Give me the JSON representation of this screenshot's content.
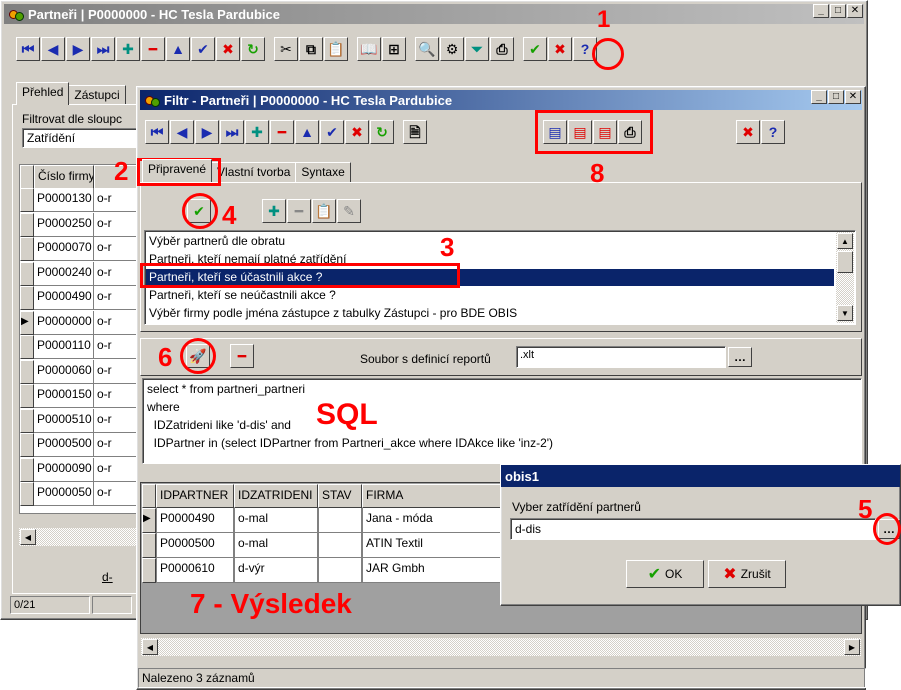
{
  "main_window": {
    "title": "Partneři | P0000000 - HC Tesla Pardubice",
    "tabs": [
      "Přehled",
      "Zástupci"
    ],
    "filter_label": "Filtrovat dle sloupc",
    "sort_value": "Zatřídění",
    "column_header": "Číslo firmy",
    "rows": [
      {
        "id": "P0000130",
        "type": "o-r"
      },
      {
        "id": "P0000250",
        "type": "o-r"
      },
      {
        "id": "P0000070",
        "type": "o-r"
      },
      {
        "id": "P0000240",
        "type": "o-r"
      },
      {
        "id": "P0000490",
        "type": "o-r"
      },
      {
        "id": "P0000000",
        "type": "o-r"
      },
      {
        "id": "P0000110",
        "type": "o-r"
      },
      {
        "id": "P0000060",
        "type": "o-r"
      },
      {
        "id": "P0000150",
        "type": "o-r"
      },
      {
        "id": "P0000510",
        "type": "o-r"
      },
      {
        "id": "P0000500",
        "type": "o-r"
      },
      {
        "id": "P0000090",
        "type": "o-r"
      },
      {
        "id": "P0000050",
        "type": "o-r"
      }
    ],
    "nav_label": "d-",
    "status_count": "0/21"
  },
  "filter_window": {
    "title": "Filtr - Partneři | P0000000 - HC Tesla Pardubice",
    "tabs": [
      "Připravené",
      "Vlastní tvorba",
      "Syntaxe"
    ],
    "filters": [
      "Výběr partnerů dle obratu",
      "Partneři, kteří nemají platné zatřídění",
      "Partneři, kteří se účastnili akce ?",
      "Partneři, kteří se neúčastnili akce ?",
      "Výběr firmy podle jména zástupce z tabulky Zástupci - pro BDE OBIS"
    ],
    "selected_filter_index": 2,
    "report_def_label": "Soubor s definicí reportů",
    "report_def_value": ".xlt",
    "sql_lines": [
      "select * from partneri_partneri",
      "where",
      "  IDZatrideni like 'd-dis' and",
      "  IDPartner in (select IDPartner from Partneri_akce where IDAkce like 'inz-2')"
    ],
    "result_columns": [
      "IDPARTNER",
      "IDZATRIDENI",
      "STAV",
      "FIRMA"
    ],
    "result_rows": [
      {
        "idpartner": "P0000490",
        "idzatrideni": "o-mal",
        "stav": "",
        "firma": "Jana - móda"
      },
      {
        "idpartner": "P0000500",
        "idzatrideni": "o-mal",
        "stav": "",
        "firma": "ATIN Textil"
      },
      {
        "idpartner": "P0000610",
        "idzatrideni": "d-výr",
        "stav": "",
        "firma": "JAR Gmbh"
      }
    ],
    "status": "Nalezeno 3 záznamů"
  },
  "dialog": {
    "title": "obis1",
    "prompt": "Vyber zatřídění partnerů",
    "value": "d-dis",
    "ok_label": "OK",
    "cancel_label": "Zrušit"
  },
  "annotations": {
    "n1": "1",
    "n2": "2",
    "n3": "3",
    "n4": "4",
    "n5": "5",
    "n6": "6",
    "n8": "8",
    "sql": "SQL",
    "result": "7 - Výsledek"
  },
  "colors": {
    "title_active": "#0a246a",
    "annotation": "#ff0000",
    "selection": "#0a246a"
  }
}
